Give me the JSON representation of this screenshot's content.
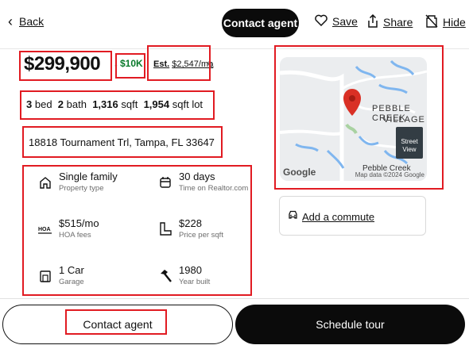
{
  "nav": {
    "back_label": "Back",
    "contact_label": "Contact agent",
    "save_label": "Save",
    "share_label": "Share",
    "hide_label": "Hide"
  },
  "listing": {
    "price": "$299,900",
    "price_drop": "$10K",
    "est_label": "Est.",
    "est_value": "$2,547/mo",
    "beds_value": "3",
    "beds_label": "bed",
    "baths_value": "2",
    "baths_label": "bath",
    "sqft_value": "1,316",
    "sqft_label": "sqft",
    "lot_value": "1,954",
    "lot_label": "sqft lot",
    "address": "18818 Tournament Trl, Tampa, FL 33647"
  },
  "facts": [
    {
      "value": "Single family",
      "caption": "Property type",
      "icon": "home-icon"
    },
    {
      "value": "30 days",
      "caption": "Time on Realtor.com",
      "icon": "calendar-icon"
    },
    {
      "value": "$515/mo",
      "caption": "HOA fees",
      "icon": "hoa-icon"
    },
    {
      "value": "$228",
      "caption": "Price per sqft",
      "icon": "floorplan-icon"
    },
    {
      "value": "1 Car",
      "caption": "Garage",
      "icon": "garage-icon"
    },
    {
      "value": "1980",
      "caption": "Year built",
      "icon": "hammer-icon"
    }
  ],
  "map": {
    "place_line1": "PEBBLE CREEK",
    "place_line2": "VILLAGE",
    "place_small": "Pebble Creek",
    "google": "Google",
    "map_data": "Map data ©2024 Google",
    "street_view_line1": "Street",
    "street_view_line2": "View"
  },
  "commute": {
    "label": "Add a commute"
  },
  "bottom": {
    "contact_label": "Contact agent",
    "tour_label": "Schedule tour"
  },
  "colors": {
    "highlight": "#e11b22",
    "price_drop": "#0a7a2b",
    "dark_button": "#0b0b0b",
    "map_pin": "#d93025"
  }
}
